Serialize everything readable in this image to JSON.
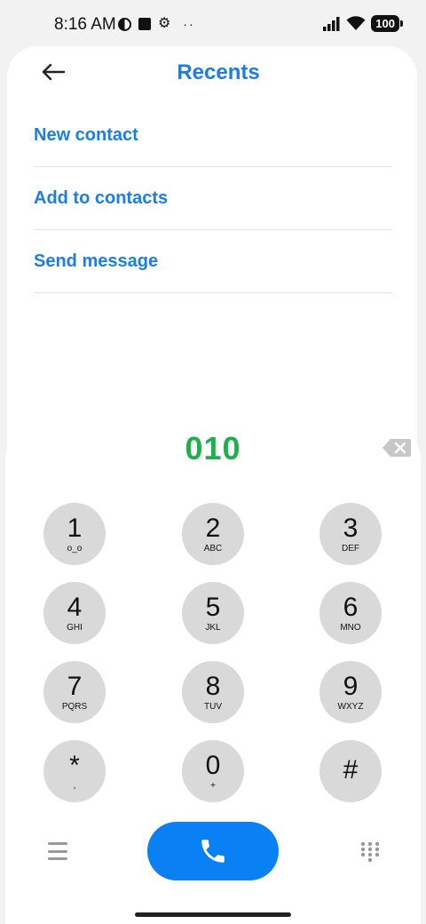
{
  "status_bar": {
    "time": "8:16 AM",
    "battery": "100",
    "icons": [
      "half-circle-icon",
      "square-icon",
      "gear-icon",
      "more-dots-icon",
      "signal-icon",
      "wifi-icon",
      "battery-icon"
    ]
  },
  "header": {
    "title": "Recents",
    "back_icon": "arrow-left-icon"
  },
  "actions": [
    {
      "label": "New contact"
    },
    {
      "label": "Add to contacts"
    },
    {
      "label": "Send message"
    }
  ],
  "dialer": {
    "number": "010",
    "keys": [
      {
        "digit": "1",
        "letters": "o_o"
      },
      {
        "digit": "2",
        "letters": "ABC"
      },
      {
        "digit": "3",
        "letters": "DEF"
      },
      {
        "digit": "4",
        "letters": "GHI"
      },
      {
        "digit": "5",
        "letters": "JKL"
      },
      {
        "digit": "6",
        "letters": "MNO"
      },
      {
        "digit": "7",
        "letters": "PQRS"
      },
      {
        "digit": "8",
        "letters": "TUV"
      },
      {
        "digit": "9",
        "letters": "WXYZ"
      },
      {
        "digit": "*",
        "letters": ","
      },
      {
        "digit": "0",
        "letters": "+"
      },
      {
        "digit": "#",
        "letters": ""
      }
    ]
  },
  "colors": {
    "accent_blue": "#1a7ee8",
    "call_button": "#0a80f5",
    "number_green": "#1db14a",
    "key_background": "#d9d9d9"
  }
}
